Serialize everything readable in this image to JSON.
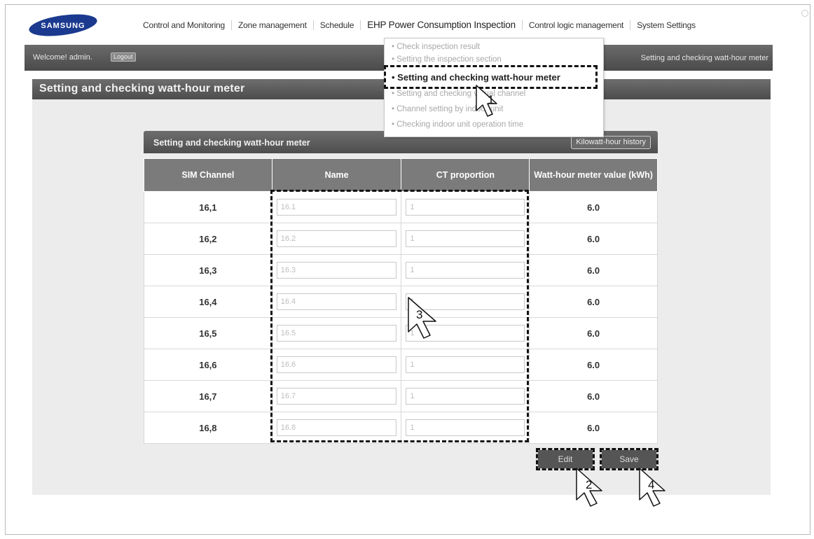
{
  "brand": "SAMSUNG",
  "nav": [
    "Control and Monitoring",
    "Zone management",
    "Schedule",
    "EHP Power Consumption Inspection",
    "Control logic management",
    "System Settings"
  ],
  "welcome": "Welcome! admin.",
  "logout": "Logout",
  "breadcrumb": "Setting and checking watt-hour meter",
  "page_title": "Setting and checking watt-hour meter",
  "dropdown": [
    "Check inspection result",
    "Setting the inspection section",
    "Setting and checking watt-hour meter",
    "Setting and checking virtual channel",
    "Channel setting by indoor unit",
    "Checking indoor unit operation time"
  ],
  "panel_title": "Setting and checking watt-hour meter",
  "kwh_history": "Kilowatt-hour history",
  "columns": [
    "SIM Channel",
    "Name",
    "CT proportion",
    "Watt-hour meter value (kWh)"
  ],
  "rows": [
    {
      "channel": "16,1",
      "name": "16.1",
      "ct": "1",
      "value": "6.0"
    },
    {
      "channel": "16,2",
      "name": "16.2",
      "ct": "1",
      "value": "6.0"
    },
    {
      "channel": "16,3",
      "name": "16.3",
      "ct": "1",
      "value": "6.0"
    },
    {
      "channel": "16,4",
      "name": "16.4",
      "ct": "1",
      "value": "6.0"
    },
    {
      "channel": "16,5",
      "name": "16.5",
      "ct": "1",
      "value": "6.0"
    },
    {
      "channel": "16,6",
      "name": "16.6",
      "ct": "1",
      "value": "6.0"
    },
    {
      "channel": "16,7",
      "name": "16.7",
      "ct": "1",
      "value": "6.0"
    },
    {
      "channel": "16,8",
      "name": "16.8",
      "ct": "1",
      "value": "6.0"
    }
  ],
  "edit": "Edit",
  "save": "Save",
  "callouts": [
    "1",
    "2",
    "3",
    "4"
  ]
}
